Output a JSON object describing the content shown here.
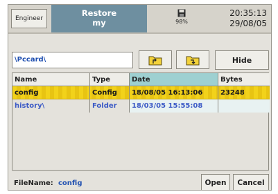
{
  "header": {
    "user_button": "Engineer",
    "title_line1": "Restore",
    "title_line2": "my",
    "disk_icon": "floppy-disk-icon",
    "disk_usage": "98%",
    "time": "20:35:13",
    "date": "29/08/05"
  },
  "toolbar": {
    "path": "\\Pccard\\",
    "folder_up_icon": "folder-up-icon",
    "folder_into_icon": "folder-into-icon",
    "hide_label": "Hide"
  },
  "table": {
    "columns": [
      "Name",
      "Type",
      "Date",
      "Bytes"
    ],
    "rows": [
      {
        "name": "config",
        "type": "Config",
        "date": "18/08/05 16:13:06",
        "bytes": "23248"
      },
      {
        "name": "history\\",
        "type": "Folder",
        "date": "18/03/05 15:55:08",
        "bytes": ""
      }
    ]
  },
  "footer": {
    "filename_label": "FileName:",
    "filename_value": "config",
    "open_label": "Open",
    "cancel_label": "Cancel"
  },
  "colors": {
    "title_bg": "#6e8fa0",
    "selected_row": "#f2d21a",
    "date_header": "#9ed0d1",
    "folder_text": "#3d5bc6",
    "path_text": "#1f4fb0"
  }
}
